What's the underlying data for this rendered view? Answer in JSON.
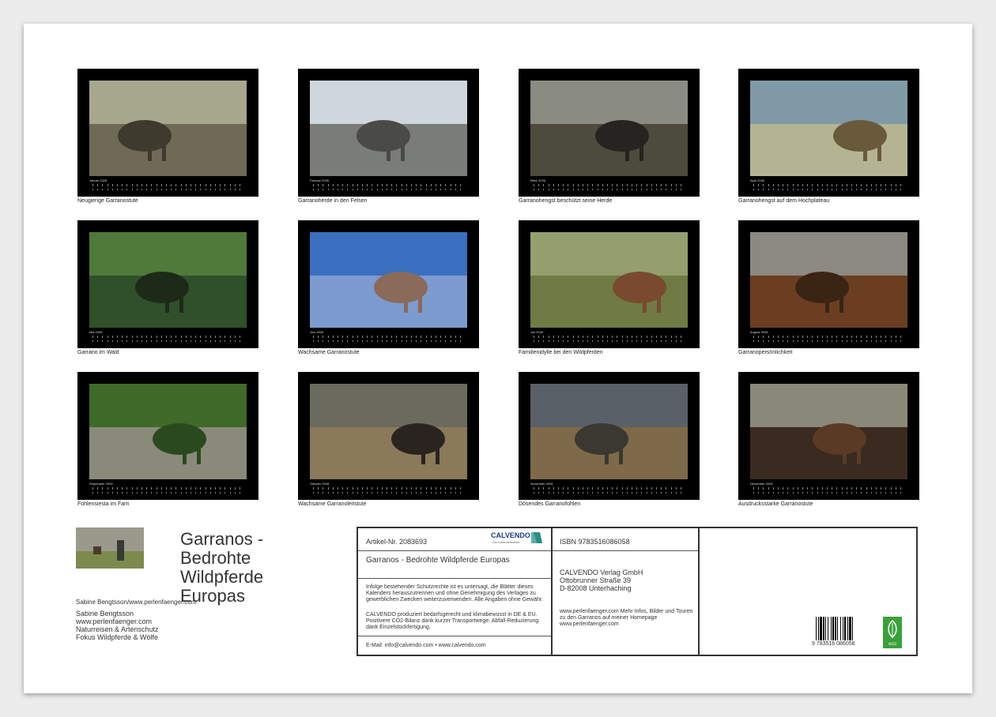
{
  "months": [
    {
      "label": "Januar 2026",
      "caption": "Neugierige Garranostute",
      "colors": [
        "#a6a78d",
        "#6e6a55",
        "#3e3a2e"
      ]
    },
    {
      "label": "Februar 2026",
      "caption": "Garranoherde in den Felsen",
      "colors": [
        "#cfd6dc",
        "#7a7c78",
        "#4a4a46"
      ]
    },
    {
      "label": "März 2026",
      "caption": "Garranohengst beschützt seine Herde",
      "colors": [
        "#8a8c82",
        "#4d4a3e",
        "#262420"
      ]
    },
    {
      "label": "April 2026",
      "caption": "Garranohengst auf dem Hochplateau",
      "colors": [
        "#7f9aa6",
        "#b5b492",
        "#6a5a3c"
      ]
    },
    {
      "label": "Mai 2026",
      "caption": "Garrano im Wald",
      "colors": [
        "#4f7a3a",
        "#30502a",
        "#1e2a18"
      ]
    },
    {
      "label": "Juni 2026",
      "caption": "Wachsame Garranostute",
      "colors": [
        "#3a6fc0",
        "#7c9bcf",
        "#8a6a58"
      ]
    },
    {
      "label": "Juli 2026",
      "caption": "Familienidylle bei den Wildpferden",
      "colors": [
        "#93a06e",
        "#6f7a45",
        "#7a4a30"
      ]
    },
    {
      "label": "August 2026",
      "caption": "Garranopersönlichkeit",
      "colors": [
        "#8b8a80",
        "#6b3e22",
        "#3a2414"
      ]
    },
    {
      "label": "September 2026",
      "caption": "Fohlensiesta im Farn",
      "colors": [
        "#3e6a2a",
        "#8a8a7a",
        "#2a4a1e"
      ]
    },
    {
      "label": "Oktober 2026",
      "caption": "Wachsame Garranoleitstute",
      "colors": [
        "#6a6a5e",
        "#8a7a5a",
        "#2a2420"
      ]
    },
    {
      "label": "November 2026",
      "caption": "Dösendes Garranofohlen",
      "colors": [
        "#5a6068",
        "#7e6a48",
        "#3a3830"
      ]
    },
    {
      "label": "Dezember 2026",
      "caption": "Ausdrucksstarke Garranostute",
      "colors": [
        "#8a8878",
        "#3a2a20",
        "#5a3a24"
      ]
    }
  ],
  "title": "Garranos - Bedrohte Wildpferde Europas",
  "author_credit": "Sabine Bengtsson/www.perlenfaenger.com",
  "author_lines": [
    "Sabine Bengtsson",
    "www.perlenfaenger.com",
    "Naturreisen & Artenschutz",
    "Fokus Wildpferde & Wölfe"
  ],
  "info": {
    "artikel": "Artikel-Nr. 2083693",
    "brand": "CALVENDO",
    "brand_sub": "Die Kalendermarke",
    "product_title": "Garranos - Bedrohte Wildpferde Europas",
    "legal1": "Infolge bestehender Schutzrechte ist es untersagt, die Blätter dieses Kalenders herauszutrennen und ohne Genehmigung des Verlages zu gewerblichen Zwecken weiterzuverwenden. Alle Angaben ohne Gewähr.",
    "legal2": "CALVENDO produziert bedarfsgerecht und klimabewusst in DE & EU. Positivere CO2-Bilanz dank kurzer Transportwege. Abfall-Reduzierung dank Einzelstückfertigung.",
    "contact": "E-Mail: info@calvendo.com • www.calvendo.com",
    "isbn": "ISBN 9783516086058",
    "publisher": [
      "CALVENDO Verlag GmbH",
      "Ottobrunner Straße 39",
      "D-82008 Unterhaching"
    ],
    "web_note": "www.perlenfaenger.com Mehr Infos, Bilder und Touren zu den Garranos auf meiner Homepage www.perlenfaenger.com",
    "barcode_digits": "9 783516 086058",
    "eco": "eco"
  }
}
